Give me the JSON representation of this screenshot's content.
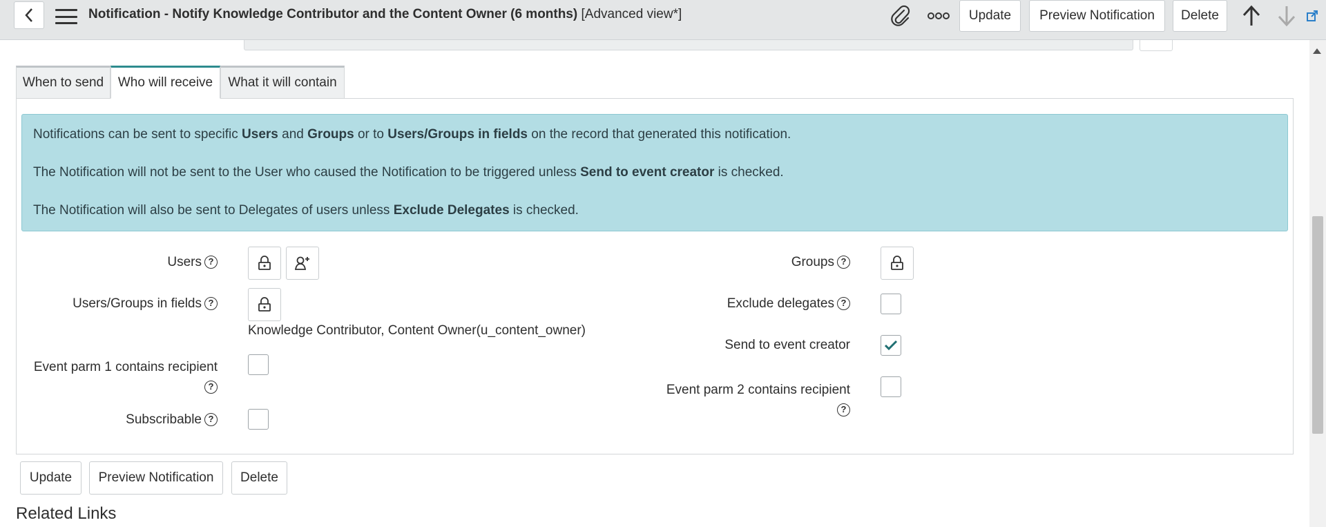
{
  "header": {
    "title": "Notification - Notify Knowledge Contributor and the Content Owner (6 months)",
    "view": "[Advanced view*]",
    "buttons": {
      "update": "Update",
      "preview": "Preview Notification",
      "delete": "Delete"
    }
  },
  "tabs": [
    {
      "label": "When to send",
      "active": false
    },
    {
      "label": "Who will receive",
      "active": true
    },
    {
      "label": "What it will contain",
      "active": false
    }
  ],
  "info": {
    "line1": {
      "a": "Notifications can be sent to specific ",
      "users": "Users",
      "b": " and ",
      "groups": "Groups",
      "c": " or to ",
      "ugf": "Users/Groups in fields",
      "d": " on the record that generated this notification."
    },
    "line2": {
      "a": "The Notification will not be sent to the User who caused the Notification to be triggered unless ",
      "strong": "Send to event creator",
      "b": " is checked."
    },
    "line3": {
      "a": "The Notification will also be sent to Delegates of users unless ",
      "strong": "Exclude Delegates",
      "b": " is checked."
    }
  },
  "form": {
    "users_label": "Users",
    "ugf_label": "Users/Groups in fields",
    "ugf_value": "Knowledge Contributor, Content Owner(u_content_owner)",
    "parm1_label": "Event parm 1 contains recipient",
    "subscribable_label": "Subscribable",
    "groups_label": "Groups",
    "exclude_label": "Exclude delegates",
    "creator_label": "Send to event creator",
    "creator_checked": true,
    "parm2_label": "Event parm 2 contains recipient"
  },
  "footer": {
    "update": "Update",
    "preview": "Preview Notification",
    "delete": "Delete",
    "related": "Related Links"
  }
}
